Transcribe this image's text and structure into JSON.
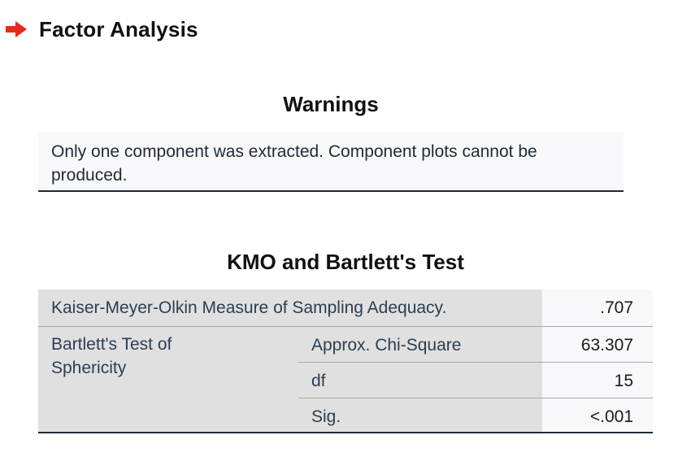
{
  "heading": {
    "title": "Factor Analysis",
    "icon": "arrow-right-icon",
    "icon_color": "#e8291e"
  },
  "warnings": {
    "title": "Warnings",
    "message": "Only one component was extracted. Component plots cannot be produced."
  },
  "kmo": {
    "title": "KMO and Bartlett's Test",
    "rows": {
      "kmo_label": "Kaiser-Meyer-Olkin Measure of Sampling Adequacy.",
      "kmo_value": ".707",
      "bartlett_label": "Bartlett's Test of Sphericity",
      "chi_label": "Approx. Chi-Square",
      "chi_value": "63.307",
      "df_label": "df",
      "df_value": "15",
      "sig_label": "Sig.",
      "sig_value": "<.001"
    }
  },
  "colors": {
    "label_bg": "#e0e0e0",
    "value_bg": "#f8f8fa",
    "text_blue": "#2c3e52",
    "rule_dark": "#1d2a38"
  }
}
